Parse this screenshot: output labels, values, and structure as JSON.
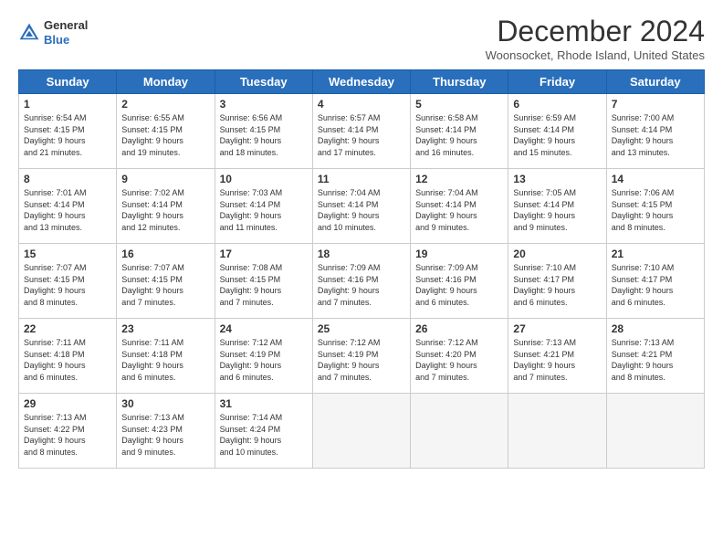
{
  "header": {
    "logo_general": "General",
    "logo_blue": "Blue",
    "month_title": "December 2024",
    "location": "Woonsocket, Rhode Island, United States"
  },
  "weekdays": [
    "Sunday",
    "Monday",
    "Tuesday",
    "Wednesday",
    "Thursday",
    "Friday",
    "Saturday"
  ],
  "weeks": [
    [
      {
        "day": "1",
        "sunrise": "6:54 AM",
        "sunset": "4:15 PM",
        "daylight": "9 hours and 21 minutes."
      },
      {
        "day": "2",
        "sunrise": "6:55 AM",
        "sunset": "4:15 PM",
        "daylight": "9 hours and 19 minutes."
      },
      {
        "day": "3",
        "sunrise": "6:56 AM",
        "sunset": "4:15 PM",
        "daylight": "9 hours and 18 minutes."
      },
      {
        "day": "4",
        "sunrise": "6:57 AM",
        "sunset": "4:14 PM",
        "daylight": "9 hours and 17 minutes."
      },
      {
        "day": "5",
        "sunrise": "6:58 AM",
        "sunset": "4:14 PM",
        "daylight": "9 hours and 16 minutes."
      },
      {
        "day": "6",
        "sunrise": "6:59 AM",
        "sunset": "4:14 PM",
        "daylight": "9 hours and 15 minutes."
      },
      {
        "day": "7",
        "sunrise": "7:00 AM",
        "sunset": "4:14 PM",
        "daylight": "9 hours and 13 minutes."
      }
    ],
    [
      {
        "day": "8",
        "sunrise": "7:01 AM",
        "sunset": "4:14 PM",
        "daylight": "9 hours and 13 minutes."
      },
      {
        "day": "9",
        "sunrise": "7:02 AM",
        "sunset": "4:14 PM",
        "daylight": "9 hours and 12 minutes."
      },
      {
        "day": "10",
        "sunrise": "7:03 AM",
        "sunset": "4:14 PM",
        "daylight": "9 hours and 11 minutes."
      },
      {
        "day": "11",
        "sunrise": "7:04 AM",
        "sunset": "4:14 PM",
        "daylight": "9 hours and 10 minutes."
      },
      {
        "day": "12",
        "sunrise": "7:04 AM",
        "sunset": "4:14 PM",
        "daylight": "9 hours and 9 minutes."
      },
      {
        "day": "13",
        "sunrise": "7:05 AM",
        "sunset": "4:14 PM",
        "daylight": "9 hours and 9 minutes."
      },
      {
        "day": "14",
        "sunrise": "7:06 AM",
        "sunset": "4:15 PM",
        "daylight": "9 hours and 8 minutes."
      }
    ],
    [
      {
        "day": "15",
        "sunrise": "7:07 AM",
        "sunset": "4:15 PM",
        "daylight": "9 hours and 8 minutes."
      },
      {
        "day": "16",
        "sunrise": "7:07 AM",
        "sunset": "4:15 PM",
        "daylight": "9 hours and 7 minutes."
      },
      {
        "day": "17",
        "sunrise": "7:08 AM",
        "sunset": "4:15 PM",
        "daylight": "9 hours and 7 minutes."
      },
      {
        "day": "18",
        "sunrise": "7:09 AM",
        "sunset": "4:16 PM",
        "daylight": "9 hours and 7 minutes."
      },
      {
        "day": "19",
        "sunrise": "7:09 AM",
        "sunset": "4:16 PM",
        "daylight": "9 hours and 6 minutes."
      },
      {
        "day": "20",
        "sunrise": "7:10 AM",
        "sunset": "4:17 PM",
        "daylight": "9 hours and 6 minutes."
      },
      {
        "day": "21",
        "sunrise": "7:10 AM",
        "sunset": "4:17 PM",
        "daylight": "9 hours and 6 minutes."
      }
    ],
    [
      {
        "day": "22",
        "sunrise": "7:11 AM",
        "sunset": "4:18 PM",
        "daylight": "9 hours and 6 minutes."
      },
      {
        "day": "23",
        "sunrise": "7:11 AM",
        "sunset": "4:18 PM",
        "daylight": "9 hours and 6 minutes."
      },
      {
        "day": "24",
        "sunrise": "7:12 AM",
        "sunset": "4:19 PM",
        "daylight": "9 hours and 6 minutes."
      },
      {
        "day": "25",
        "sunrise": "7:12 AM",
        "sunset": "4:19 PM",
        "daylight": "9 hours and 7 minutes."
      },
      {
        "day": "26",
        "sunrise": "7:12 AM",
        "sunset": "4:20 PM",
        "daylight": "9 hours and 7 minutes."
      },
      {
        "day": "27",
        "sunrise": "7:13 AM",
        "sunset": "4:21 PM",
        "daylight": "9 hours and 7 minutes."
      },
      {
        "day": "28",
        "sunrise": "7:13 AM",
        "sunset": "4:21 PM",
        "daylight": "9 hours and 8 minutes."
      }
    ],
    [
      {
        "day": "29",
        "sunrise": "7:13 AM",
        "sunset": "4:22 PM",
        "daylight": "9 hours and 8 minutes."
      },
      {
        "day": "30",
        "sunrise": "7:13 AM",
        "sunset": "4:23 PM",
        "daylight": "9 hours and 9 minutes."
      },
      {
        "day": "31",
        "sunrise": "7:14 AM",
        "sunset": "4:24 PM",
        "daylight": "9 hours and 10 minutes."
      },
      null,
      null,
      null,
      null
    ]
  ],
  "labels": {
    "sunrise": "Sunrise:",
    "sunset": "Sunset:",
    "daylight": "Daylight:"
  }
}
